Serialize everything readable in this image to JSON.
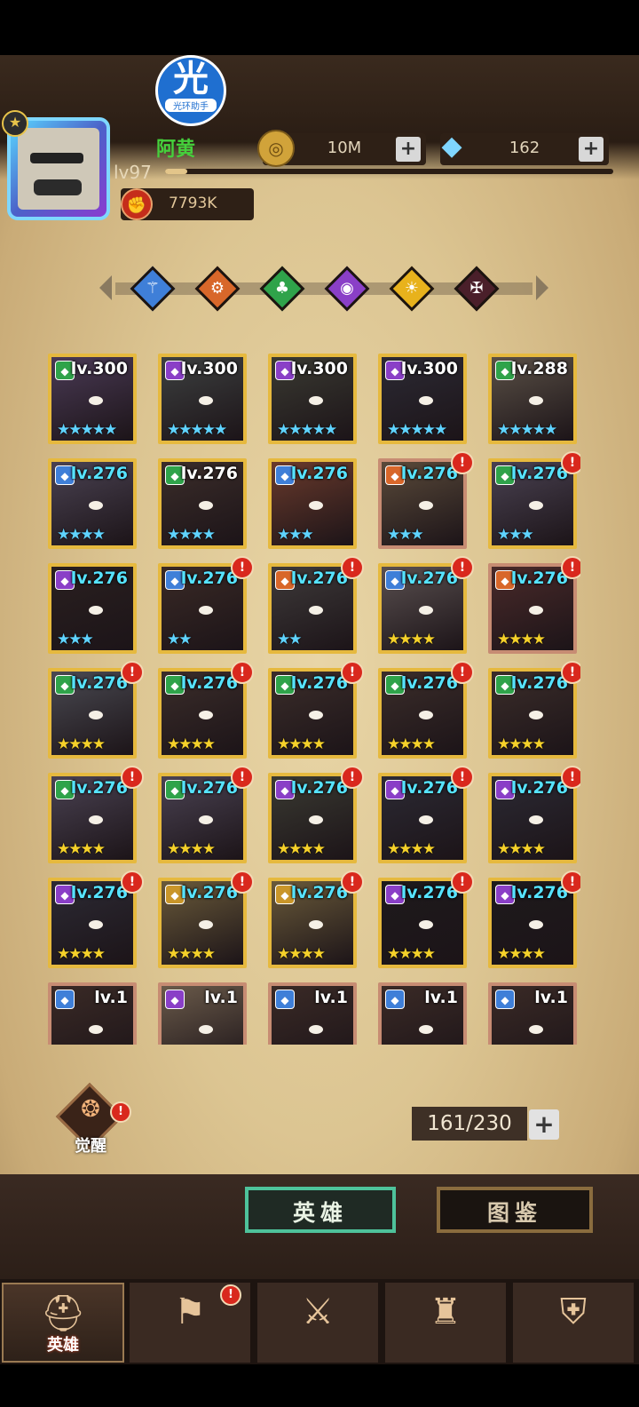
{
  "assistant": {
    "glyph": "光",
    "label": "光环助手"
  },
  "player": {
    "name": "阿黄",
    "level": "lv97",
    "xp_fraction": 0.05,
    "power": "7793K"
  },
  "resources": {
    "gold": "10M",
    "gems": "162",
    "plus": "+"
  },
  "factions": [
    {
      "icon": "staff-icon",
      "glyph": "⚚",
      "color": "#3f7fd8"
    },
    {
      "icon": "gear-icon",
      "glyph": "⚙",
      "color": "#d8672a"
    },
    {
      "icon": "clover-icon",
      "glyph": "♣",
      "color": "#2fa34a"
    },
    {
      "icon": "eye-icon",
      "glyph": "◉",
      "color": "#8a3fc7"
    },
    {
      "icon": "sun-icon",
      "glyph": "☀",
      "color": "#e8b21c"
    },
    {
      "icon": "demon-icon",
      "glyph": "✠",
      "color": "#4a1f2a"
    }
  ],
  "heroes": [
    {
      "level": "lv.300",
      "stars": "★★★★★",
      "star_color": "#5fd3ff",
      "faction_color": "#2fa34a",
      "alert": false,
      "level_cyan": false,
      "frame": "gold",
      "bg": "#4a3a55"
    },
    {
      "level": "lv.300",
      "stars": "★★★★★",
      "star_color": "#5fd3ff",
      "faction_color": "#8a3fc7",
      "alert": false,
      "level_cyan": false,
      "frame": "gold",
      "bg": "#3d4040"
    },
    {
      "level": "lv.300",
      "stars": "★★★★★",
      "star_color": "#5fd3ff",
      "faction_color": "#8a3fc7",
      "alert": false,
      "level_cyan": false,
      "frame": "gold",
      "bg": "#3a3a32"
    },
    {
      "level": "lv.300",
      "stars": "★★★★★",
      "star_color": "#5fd3ff",
      "faction_color": "#8a3fc7",
      "alert": false,
      "level_cyan": false,
      "frame": "gold",
      "bg": "#2c2a34"
    },
    {
      "level": "lv.288",
      "stars": "★★★★★",
      "star_color": "#5fd3ff",
      "faction_color": "#2fa34a",
      "alert": false,
      "level_cyan": false,
      "frame": "gold",
      "bg": "#5a5046"
    },
    {
      "level": "lv.276",
      "stars": "★★★★",
      "star_color": "#5fd3ff",
      "faction_color": "#3f7fd8",
      "alert": false,
      "level_cyan": true,
      "frame": "gold",
      "bg": "#4a4252"
    },
    {
      "level": "lv.276",
      "stars": "★★★★",
      "star_color": "#5fd3ff",
      "faction_color": "#2fa34a",
      "alert": false,
      "level_cyan": false,
      "frame": "gold",
      "bg": "#3b2d2a"
    },
    {
      "level": "lv.276",
      "stars": "★★★",
      "star_color": "#5fd3ff",
      "faction_color": "#3f7fd8",
      "alert": false,
      "level_cyan": true,
      "frame": "gold",
      "bg": "#6a3a2c"
    },
    {
      "level": "lv.276",
      "stars": "★★★",
      "star_color": "#5fd3ff",
      "faction_color": "#d8672a",
      "alert": true,
      "level_cyan": true,
      "frame": "rose",
      "bg": "#5a4a3a"
    },
    {
      "level": "lv.276",
      "stars": "★★★",
      "star_color": "#5fd3ff",
      "faction_color": "#2fa34a",
      "alert": true,
      "level_cyan": true,
      "frame": "gold",
      "bg": "#4a4252"
    },
    {
      "level": "lv.276",
      "stars": "★★★",
      "star_color": "#5fd3ff",
      "faction_color": "#8a3fc7",
      "alert": false,
      "level_cyan": true,
      "frame": "gold",
      "bg": "#2a2020"
    },
    {
      "level": "lv.276",
      "stars": "★★",
      "star_color": "#5fd3ff",
      "faction_color": "#3f7fd8",
      "alert": true,
      "level_cyan": true,
      "frame": "gold",
      "bg": "#3a2a26"
    },
    {
      "level": "lv.276",
      "stars": "★★",
      "star_color": "#5fd3ff",
      "faction_color": "#d8672a",
      "alert": true,
      "level_cyan": true,
      "frame": "gold",
      "bg": "#3e3a3a"
    },
    {
      "level": "lv.276",
      "stars": "★★★★",
      "star_color": "#f5d12a",
      "faction_color": "#3f7fd8",
      "alert": true,
      "level_cyan": true,
      "frame": "gold",
      "bg": "#5a5050"
    },
    {
      "level": "lv.276",
      "stars": "★★★★",
      "star_color": "#f5d12a",
      "faction_color": "#d8672a",
      "alert": true,
      "level_cyan": true,
      "frame": "rose",
      "bg": "#4a2a2a"
    },
    {
      "level": "lv.276",
      "stars": "★★★★",
      "star_color": "#f5d12a",
      "faction_color": "#2fa34a",
      "alert": true,
      "level_cyan": true,
      "frame": "gold",
      "bg": "#4a4a52"
    },
    {
      "level": "lv.276",
      "stars": "★★★★",
      "star_color": "#f5d12a",
      "faction_color": "#2fa34a",
      "alert": true,
      "level_cyan": true,
      "frame": "gold",
      "bg": "#3b2d2a"
    },
    {
      "level": "lv.276",
      "stars": "★★★★",
      "star_color": "#f5d12a",
      "faction_color": "#2fa34a",
      "alert": true,
      "level_cyan": true,
      "frame": "gold",
      "bg": "#3b2d2a"
    },
    {
      "level": "lv.276",
      "stars": "★★★★",
      "star_color": "#f5d12a",
      "faction_color": "#2fa34a",
      "alert": true,
      "level_cyan": true,
      "frame": "gold",
      "bg": "#3b2d2a"
    },
    {
      "level": "lv.276",
      "stars": "★★★★",
      "star_color": "#f5d12a",
      "faction_color": "#2fa34a",
      "alert": true,
      "level_cyan": true,
      "frame": "gold",
      "bg": "#3b2d2a"
    },
    {
      "level": "lv.276",
      "stars": "★★★★",
      "star_color": "#f5d12a",
      "faction_color": "#2fa34a",
      "alert": true,
      "level_cyan": true,
      "frame": "gold",
      "bg": "#4a4252"
    },
    {
      "level": "lv.276",
      "stars": "★★★★",
      "star_color": "#f5d12a",
      "faction_color": "#2fa34a",
      "alert": true,
      "level_cyan": true,
      "frame": "gold",
      "bg": "#4a4252"
    },
    {
      "level": "lv.276",
      "stars": "★★★★",
      "star_color": "#f5d12a",
      "faction_color": "#8a3fc7",
      "alert": true,
      "level_cyan": true,
      "frame": "gold",
      "bg": "#3a3a32"
    },
    {
      "level": "lv.276",
      "stars": "★★★★",
      "star_color": "#f5d12a",
      "faction_color": "#8a3fc7",
      "alert": true,
      "level_cyan": true,
      "frame": "gold",
      "bg": "#2c2a34"
    },
    {
      "level": "lv.276",
      "stars": "★★★★",
      "star_color": "#f5d12a",
      "faction_color": "#8a3fc7",
      "alert": true,
      "level_cyan": true,
      "frame": "gold",
      "bg": "#2c2a34"
    },
    {
      "level": "lv.276",
      "stars": "★★★★",
      "star_color": "#f5d12a",
      "faction_color": "#8a3fc7",
      "alert": true,
      "level_cyan": true,
      "frame": "gold",
      "bg": "#2c2a34"
    },
    {
      "level": "lv.276",
      "stars": "★★★★",
      "star_color": "#f5d12a",
      "faction_color": "#c9962a",
      "alert": true,
      "level_cyan": true,
      "frame": "gold",
      "bg": "#6a5a3a"
    },
    {
      "level": "lv.276",
      "stars": "★★★★",
      "star_color": "#f5d12a",
      "faction_color": "#c9962a",
      "alert": true,
      "level_cyan": true,
      "frame": "gold",
      "bg": "#6a5a3a"
    },
    {
      "level": "lv.276",
      "stars": "★★★★",
      "star_color": "#f5d12a",
      "faction_color": "#8a3fc7",
      "alert": true,
      "level_cyan": true,
      "frame": "gold",
      "bg": "#1e1a1c"
    },
    {
      "level": "lv.276",
      "stars": "★★★★",
      "star_color": "#f5d12a",
      "faction_color": "#8a3fc7",
      "alert": true,
      "level_cyan": true,
      "frame": "gold",
      "bg": "#1e1a1c"
    },
    {
      "level": "lv.1",
      "stars": "",
      "star_color": "#f5d12a",
      "faction_color": "#3f7fd8",
      "alert": false,
      "level_cyan": false,
      "frame": "rose",
      "bg": "#3a2a26"
    },
    {
      "level": "lv.1",
      "stars": "",
      "star_color": "#f5d12a",
      "faction_color": "#8a3fc7",
      "alert": false,
      "level_cyan": false,
      "frame": "rose",
      "bg": "#6a5a4a"
    },
    {
      "level": "lv.1",
      "stars": "",
      "star_color": "#f5d12a",
      "faction_color": "#3f7fd8",
      "alert": false,
      "level_cyan": false,
      "frame": "rose",
      "bg": "#3a2a26"
    },
    {
      "level": "lv.1",
      "stars": "",
      "star_color": "#f5d12a",
      "faction_color": "#3f7fd8",
      "alert": false,
      "level_cyan": false,
      "frame": "rose",
      "bg": "#3a2a26"
    },
    {
      "level": "lv.1",
      "stars": "",
      "star_color": "#f5d12a",
      "faction_color": "#3f7fd8",
      "alert": false,
      "level_cyan": false,
      "frame": "rose",
      "bg": "#3a2a26"
    }
  ],
  "awaken": {
    "label": "觉醒",
    "icon": "flame-icon"
  },
  "capacity": {
    "value": "161/230"
  },
  "subtabs": {
    "heroes": "英雄",
    "codex": "图鉴"
  },
  "nav": [
    {
      "icon": "helmet-icon",
      "glyph": "⛑",
      "label": "英雄",
      "active": true,
      "alert": false
    },
    {
      "icon": "flag-icon",
      "glyph": "⚑",
      "label": "",
      "active": false,
      "alert": true
    },
    {
      "icon": "crossed-swords-icon",
      "glyph": "⚔",
      "label": "",
      "active": false,
      "alert": false
    },
    {
      "icon": "castle-icon",
      "glyph": "♜",
      "label": "",
      "active": false,
      "alert": false
    },
    {
      "icon": "guild-icon",
      "glyph": "⛨",
      "label": "",
      "active": false,
      "alert": false
    }
  ]
}
